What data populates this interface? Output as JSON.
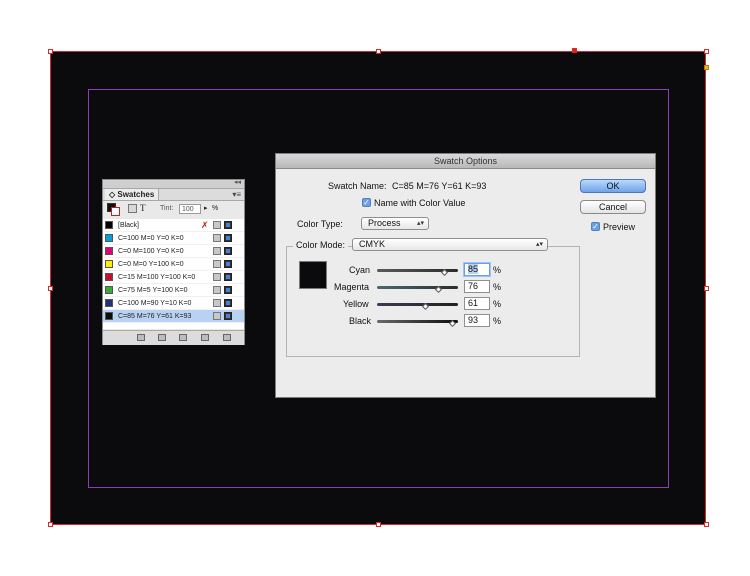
{
  "colors": {
    "artboard": "#0b0a0c",
    "frame": "#d52a2a",
    "margin_guide": "#8a3fb5"
  },
  "swatches_panel": {
    "collapse_glyph": "◂◂",
    "tab_label": "◇ Swatches",
    "menu_glyph": "▾≡",
    "tint_label": "Tint:",
    "tint_value": "100",
    "tint_unit": "%",
    "tint_arrow": "▸",
    "text_toggle": "T",
    "items": [
      {
        "label": "[Black]",
        "color": "#000000"
      },
      {
        "label": "C=100 M=0 Y=0 K=0",
        "color": "#00a0e0"
      },
      {
        "label": "C=0 M=100 Y=0 K=0",
        "color": "#e0007a"
      },
      {
        "label": "C=0 M=0 Y=100 K=0",
        "color": "#ffec00"
      },
      {
        "label": "C=15 M=100 Y=100 K=0",
        "color": "#c8102e"
      },
      {
        "label": "C=75 M=5 Y=100 K=0",
        "color": "#3aa935"
      },
      {
        "label": "C=100 M=90 Y=10 K=0",
        "color": "#23307c"
      },
      {
        "label": "C=85 M=76 Y=61 K=93",
        "color": "#0b0a0c"
      }
    ]
  },
  "dialog": {
    "title": "Swatch Options",
    "swatch_name_label": "Swatch Name:",
    "swatch_name_value": "C=85 M=76 Y=61 K=93",
    "name_with_color_value_label": "Name with Color Value",
    "color_type_label": "Color Type:",
    "color_type_value": "Process",
    "color_mode_label": "Color Mode:",
    "color_mode_value": "CMYK",
    "ok_label": "OK",
    "cancel_label": "Cancel",
    "preview_label": "Preview",
    "check_glyph": "✓",
    "popup_arrows": "▴▾",
    "percent": "%",
    "sliders": [
      {
        "label": "Cyan",
        "value": 85
      },
      {
        "label": "Magenta",
        "value": 76
      },
      {
        "label": "Yellow",
        "value": 61
      },
      {
        "label": "Black",
        "value": 93
      }
    ]
  }
}
